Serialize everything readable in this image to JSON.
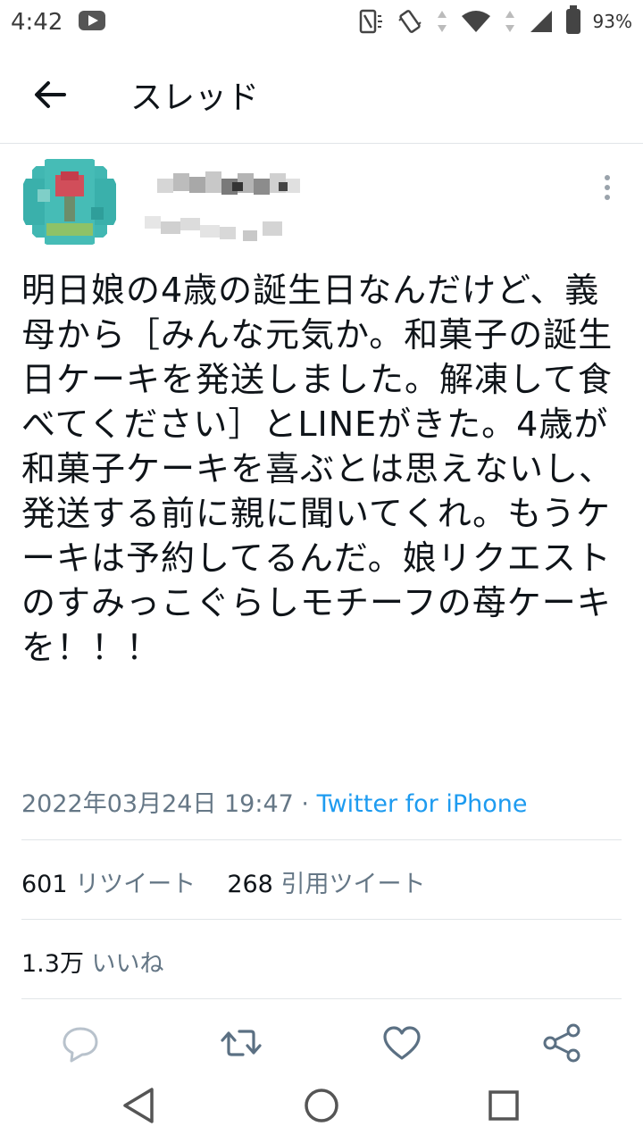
{
  "status_bar": {
    "time": "4:42",
    "battery": "93%"
  },
  "header": {
    "title": "スレッド"
  },
  "tweet": {
    "text": "明日娘の4歳の誕生日なんだけど、義母から［みんな元気か。和菓子の誕生日ケーキを発送しました。解凍して食べてください］とLINEがきた。4歳が和菓子ケーキを喜ぶとは思えないし、発送する前に親に聞いてくれ。もうケーキは予約してるんだ。娘リクエストのすみっこぐらしモチーフの苺ケーキを！！！",
    "timestamp": "2022年03月24日 19:47",
    "separator": " · ",
    "source": "Twitter for iPhone"
  },
  "stats": {
    "retweet_count": "601",
    "retweet_label": "リツイート",
    "quote_count": "268",
    "quote_label": "引用ツイート",
    "like_count": "1.3万",
    "like_label": "いいね"
  },
  "colors": {
    "accent": "#1d9bf0",
    "secondary_text": "#657786",
    "divider": "#e1e5e8"
  },
  "icons": [
    "back-arrow-icon",
    "more-vertical-icon",
    "reply-icon",
    "retweet-icon",
    "like-icon",
    "share-icon",
    "nav-back-icon",
    "nav-home-icon",
    "nav-recents-icon"
  ]
}
